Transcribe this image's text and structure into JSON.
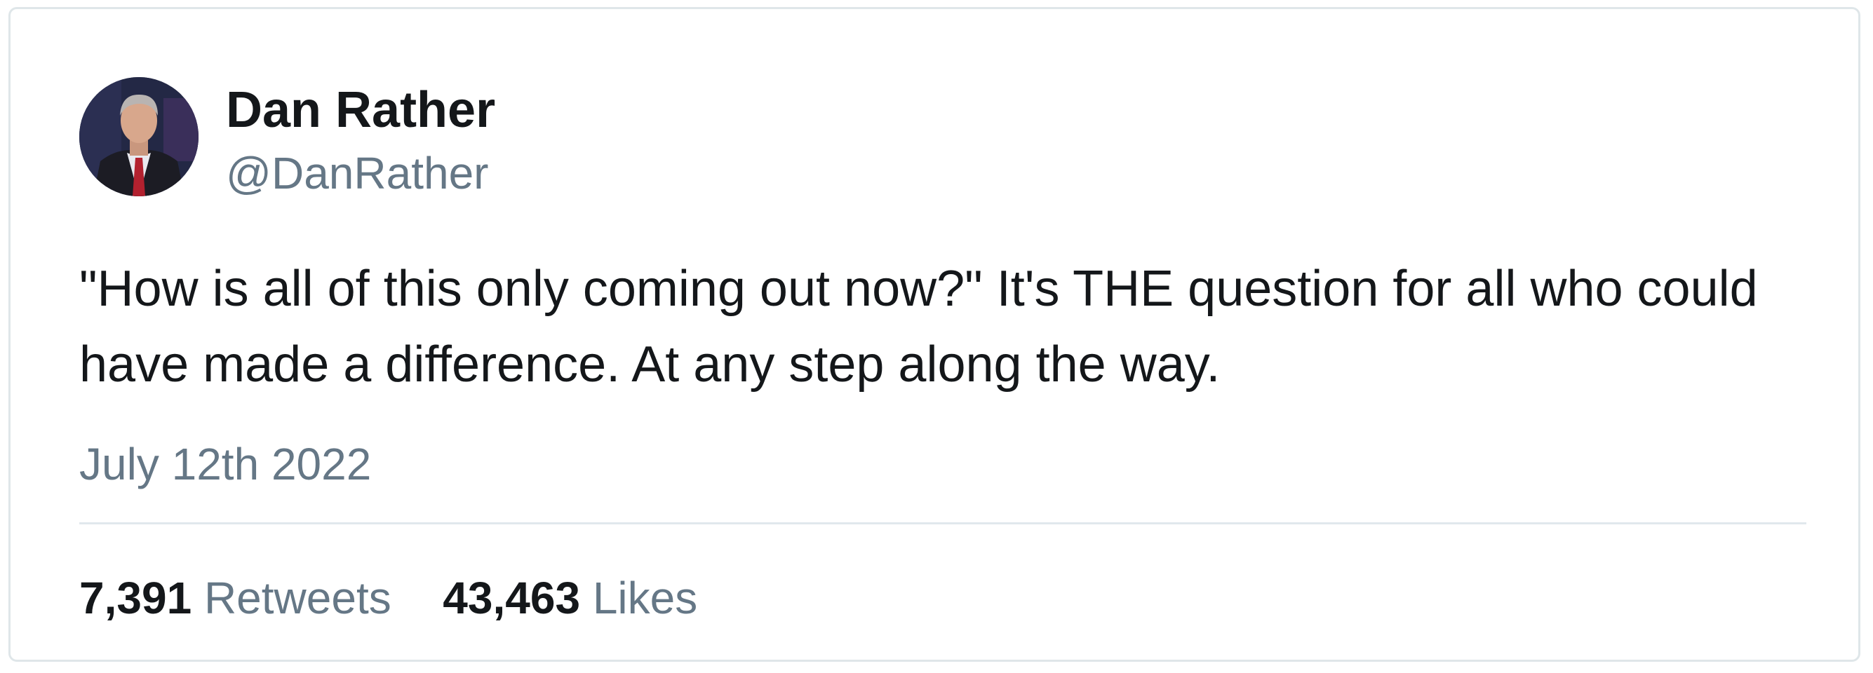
{
  "tweet": {
    "author_name": "Dan Rather",
    "author_handle": "@DanRather",
    "avatar": "profile-photo",
    "text": "\"How is all of this only coming out now?\" It's THE question for all who could have made a difference. At any step along the way.",
    "date": "July 12th 2022",
    "retweets": {
      "count": "7,391",
      "label": "Retweets"
    },
    "likes": {
      "count": "43,463",
      "label": "Likes"
    }
  },
  "colors": {
    "primary_text": "#14171a",
    "secondary_text": "#657786",
    "border": "#dfe6e9"
  }
}
